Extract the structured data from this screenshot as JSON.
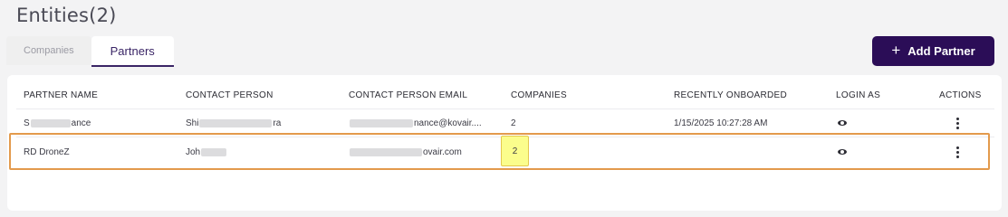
{
  "page": {
    "title": "Entities(2)"
  },
  "tabs": [
    {
      "label": "Companies",
      "active": false
    },
    {
      "label": "Partners",
      "active": true
    }
  ],
  "actions": {
    "add_partner": "Add Partner",
    "add_icon": "+"
  },
  "table": {
    "columns": [
      "PARTNER NAME",
      "CONTACT PERSON",
      "CONTACT PERSON EMAIL",
      "COMPANIES",
      "RECENTLY ONBOARDED",
      "LOGIN AS",
      "ACTIONS"
    ],
    "rows": [
      {
        "partner_name": "ance",
        "partner_name_prefix": "S",
        "contact_person": "ra",
        "contact_person_prefix": "Shi",
        "email": "nance@kovair....",
        "companies": "2",
        "recently_onboarded": "1/15/2025 10:27:28 AM",
        "login_icon": "eye-icon",
        "actions_icon": "kebab-menu-icon"
      },
      {
        "partner_name": "RD DroneZ",
        "contact_person": "Joh",
        "email": "ovair.com",
        "companies": "2",
        "recently_onboarded": "",
        "login_icon": "eye-icon",
        "actions_icon": "kebab-menu-icon"
      }
    ]
  },
  "colors": {
    "accent": "#2b0d57",
    "highlight_row_border": "#e39a4c",
    "highlight_cell_bg": "#fbfd8c"
  }
}
